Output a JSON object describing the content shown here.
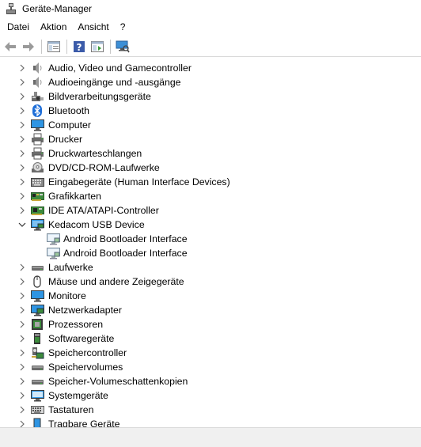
{
  "window": {
    "title": "Geräte-Manager"
  },
  "menu": [
    {
      "label": "Datei"
    },
    {
      "label": "Aktion"
    },
    {
      "label": "Ansicht"
    },
    {
      "label": "?"
    }
  ],
  "tree": [
    {
      "label": "Audio, Video und Gamecontroller",
      "icon": "speaker-icon",
      "expanded": false
    },
    {
      "label": "Audioeingänge und -ausgänge",
      "icon": "speaker-icon",
      "expanded": false
    },
    {
      "label": "Bildverarbeitungsgeräte",
      "icon": "camera-icon",
      "expanded": false
    },
    {
      "label": "Bluetooth",
      "icon": "bluetooth-icon",
      "expanded": false
    },
    {
      "label": "Computer",
      "icon": "monitor-icon",
      "expanded": false
    },
    {
      "label": "Drucker",
      "icon": "printer-icon",
      "expanded": false
    },
    {
      "label": "Druckwarteschlangen",
      "icon": "printer-icon",
      "expanded": false
    },
    {
      "label": "DVD/CD-ROM-Laufwerke",
      "icon": "disc-drive-icon",
      "expanded": false
    },
    {
      "label": "Eingabegeräte (Human Interface Devices)",
      "icon": "hid-icon",
      "expanded": false
    },
    {
      "label": "Grafikkarten",
      "icon": "display-adapter-icon",
      "expanded": false
    },
    {
      "label": "IDE ATA/ATAPI-Controller",
      "icon": "controller-icon",
      "expanded": false
    },
    {
      "label": "Kedacom USB Device",
      "icon": "usb-device-icon",
      "expanded": true,
      "children": [
        {
          "label": "Android Bootloader Interface",
          "icon": "device-icon"
        },
        {
          "label": "Android Bootloader Interface",
          "icon": "device-icon"
        }
      ]
    },
    {
      "label": "Laufwerke",
      "icon": "drive-icon",
      "expanded": false
    },
    {
      "label": "Mäuse und andere Zeigegeräte",
      "icon": "mouse-icon",
      "expanded": false
    },
    {
      "label": "Monitore",
      "icon": "monitor-icon",
      "expanded": false
    },
    {
      "label": "Netzwerkadapter",
      "icon": "network-adapter-icon",
      "expanded": false
    },
    {
      "label": "Prozessoren",
      "icon": "processor-icon",
      "expanded": false
    },
    {
      "label": "Softwaregeräte",
      "icon": "software-device-icon",
      "expanded": false
    },
    {
      "label": "Speichercontroller",
      "icon": "storage-controller-icon",
      "expanded": false
    },
    {
      "label": "Speichervolumes",
      "icon": "drive-icon",
      "expanded": false
    },
    {
      "label": "Speicher-Volumeschattenkopien",
      "icon": "drive-icon",
      "expanded": false
    },
    {
      "label": "Systemgeräte",
      "icon": "system-device-icon",
      "expanded": false
    },
    {
      "label": "Tastaturen",
      "icon": "keyboard-icon",
      "expanded": false
    },
    {
      "label": "Tragbare Geräte",
      "icon": "portable-device-icon",
      "expanded": false
    }
  ],
  "toolbar": [
    {
      "icon": "back-arrow-icon"
    },
    {
      "icon": "forward-arrow-icon"
    },
    {
      "icon": "properties-icon"
    },
    {
      "icon": "help-icon"
    },
    {
      "icon": "run-icon"
    },
    {
      "icon": "scan-hardware-icon"
    }
  ]
}
